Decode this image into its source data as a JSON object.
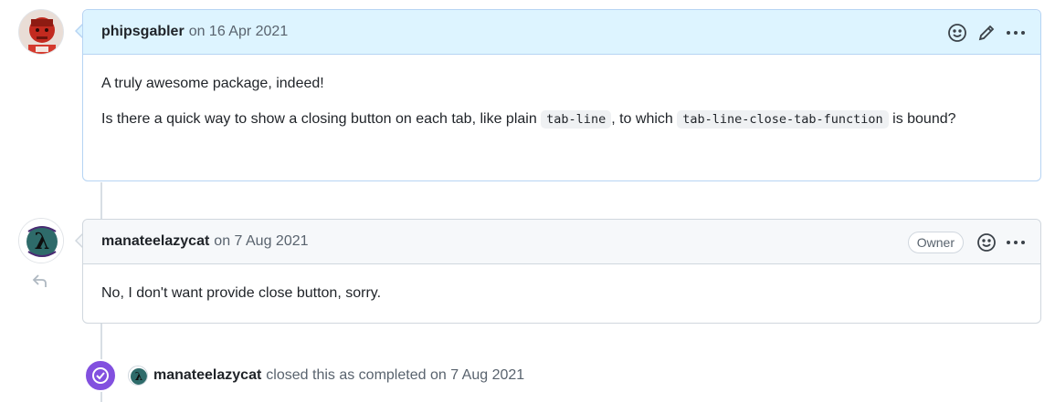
{
  "comments": [
    {
      "author": "phipsgabler",
      "date": "on 16 Apr 2021",
      "body_line1": "A truly awesome package, indeed!",
      "body_line2_a": "Is there a quick way to show a closing button on each tab, like plain ",
      "body_code1": "tab-line",
      "body_line2_b": ", to which ",
      "body_code2": "tab-line-close-tab-function",
      "body_line2_c": " is bound?"
    },
    {
      "author": "manateelazycat",
      "date": "on 7 Aug 2021",
      "badge": "Owner",
      "body": "No, I don't want provide close button, sorry."
    }
  ],
  "event": {
    "author": "manateelazycat",
    "text": "closed this as completed on 7 Aug 2021"
  },
  "colors": {
    "accent_purple": "#8250df",
    "highlight_header": "#ddf4ff",
    "border_blue": "#b6d4f3"
  },
  "icons": [
    "smiley-icon",
    "pencil-icon",
    "kebab-icon",
    "reply-icon",
    "check-circle-icon"
  ]
}
